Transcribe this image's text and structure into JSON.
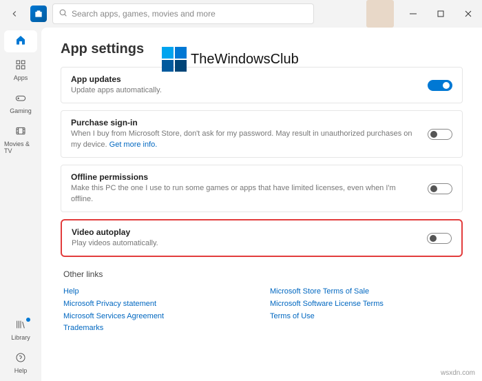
{
  "titlebar": {
    "search_placeholder": "Search apps, games, movies and more"
  },
  "sidenav": {
    "home": "",
    "apps": "Apps",
    "gaming": "Gaming",
    "movies": "Movies & TV",
    "library": "Library",
    "help": "Help"
  },
  "page": {
    "title": "App settings",
    "watermark_text": "TheWindowsClub",
    "footer_watermark": "wsxdn.com"
  },
  "settings": {
    "app_updates": {
      "title": "App updates",
      "desc": "Update apps automatically."
    },
    "purchase_signin": {
      "title": "Purchase sign-in",
      "desc_before": "When I buy from Microsoft Store, don't ask for my password. May result in unauthorized purchases on my device. ",
      "link": "Get more info."
    },
    "offline_permissions": {
      "title": "Offline permissions",
      "desc": "Make this PC the one I use to run some games or apps that have limited licenses, even when I'm offline."
    },
    "video_autoplay": {
      "title": "Video autoplay",
      "desc": "Play videos automatically."
    }
  },
  "other_links": {
    "heading": "Other links",
    "col1": [
      "Help",
      "Microsoft Privacy statement",
      "Microsoft Services Agreement",
      "Trademarks"
    ],
    "col2": [
      "Microsoft Store Terms of Sale",
      "Microsoft Software License Terms",
      "Terms of Use"
    ]
  }
}
